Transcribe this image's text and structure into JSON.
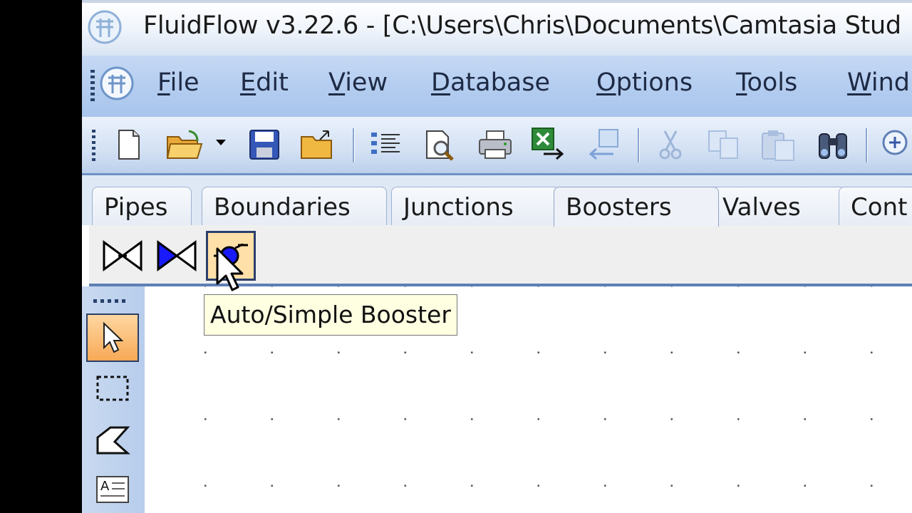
{
  "window": {
    "title": "FluidFlow v3.22.6 - [C:\\Users\\Chris\\Documents\\Camtasia Stud"
  },
  "menu": {
    "items": [
      {
        "key": "F",
        "rest": "ile"
      },
      {
        "key": "E",
        "rest": "dit"
      },
      {
        "key": "V",
        "rest": "iew"
      },
      {
        "key": "D",
        "rest": "atabase"
      },
      {
        "key": "O",
        "rest": "ptions"
      },
      {
        "key": "T",
        "rest": "ools"
      },
      {
        "key": "W",
        "rest": "ind"
      }
    ]
  },
  "toolbar": {
    "buttons": [
      "new-document-icon",
      "open-folder-icon",
      "save-icon",
      "export-folder-icon",
      "properties-list-icon",
      "print-preview-icon",
      "print-icon",
      "excel-export-icon",
      "import-icon",
      "cut-icon",
      "copy-icon",
      "paste-icon",
      "find-icon",
      "zoom-in-icon"
    ]
  },
  "tabs": {
    "items": [
      "Pipes",
      "Boundaries",
      "Junctions",
      "Boosters",
      "Valves",
      "Cont"
    ],
    "active": "Boosters"
  },
  "palette": {
    "items": [
      "valve-open-icon",
      "valve-closed-icon",
      "auto-simple-booster-icon"
    ]
  },
  "tools": {
    "items": [
      "select-arrow-icon",
      "rectangle-select-icon",
      "polygon-icon",
      "text-icon"
    ],
    "active": "select-arrow-icon"
  },
  "tooltip": {
    "text": "Auto/Simple Booster"
  },
  "colors": {
    "menu_bg": "#b4cdf0",
    "tooltip_bg": "#ffffe1",
    "active_tool": "#f7a957",
    "valve_blue": "#1a1aff"
  }
}
